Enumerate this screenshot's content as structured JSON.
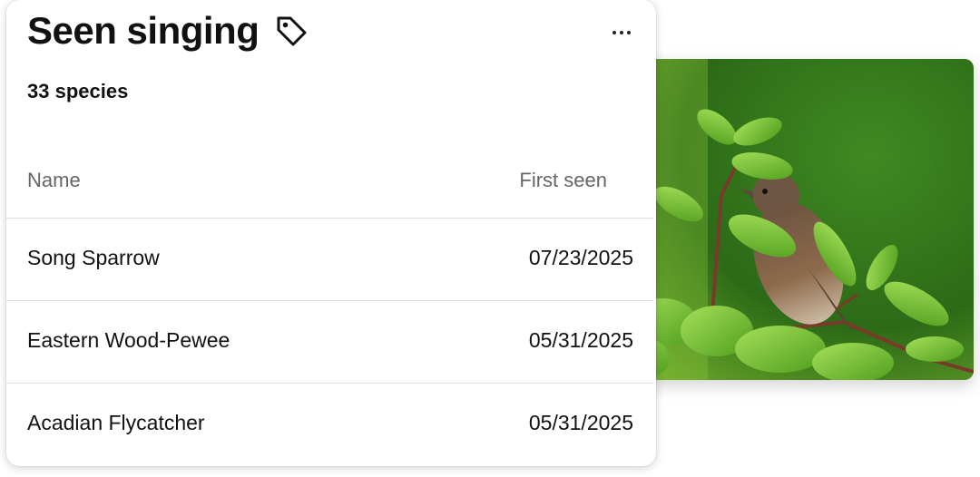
{
  "card": {
    "title": "Seen singing",
    "subtitle": "33 species",
    "columns": {
      "name": "Name",
      "first_seen": "First seen"
    },
    "rows": [
      {
        "name": "Song Sparrow",
        "first_seen": "07/23/2025"
      },
      {
        "name": "Eastern Wood-Pewee",
        "first_seen": "05/31/2025"
      },
      {
        "name": "Acadian Flycatcher",
        "first_seen": "05/31/2025"
      }
    ]
  },
  "icons": {
    "tag": "tag-icon",
    "more": "more-options-icon"
  },
  "colors": {
    "text": "#111111",
    "muted": "#666666",
    "divider": "#dedede",
    "leaf": "#7cc43a",
    "bg_green": "#2f6f1a"
  }
}
